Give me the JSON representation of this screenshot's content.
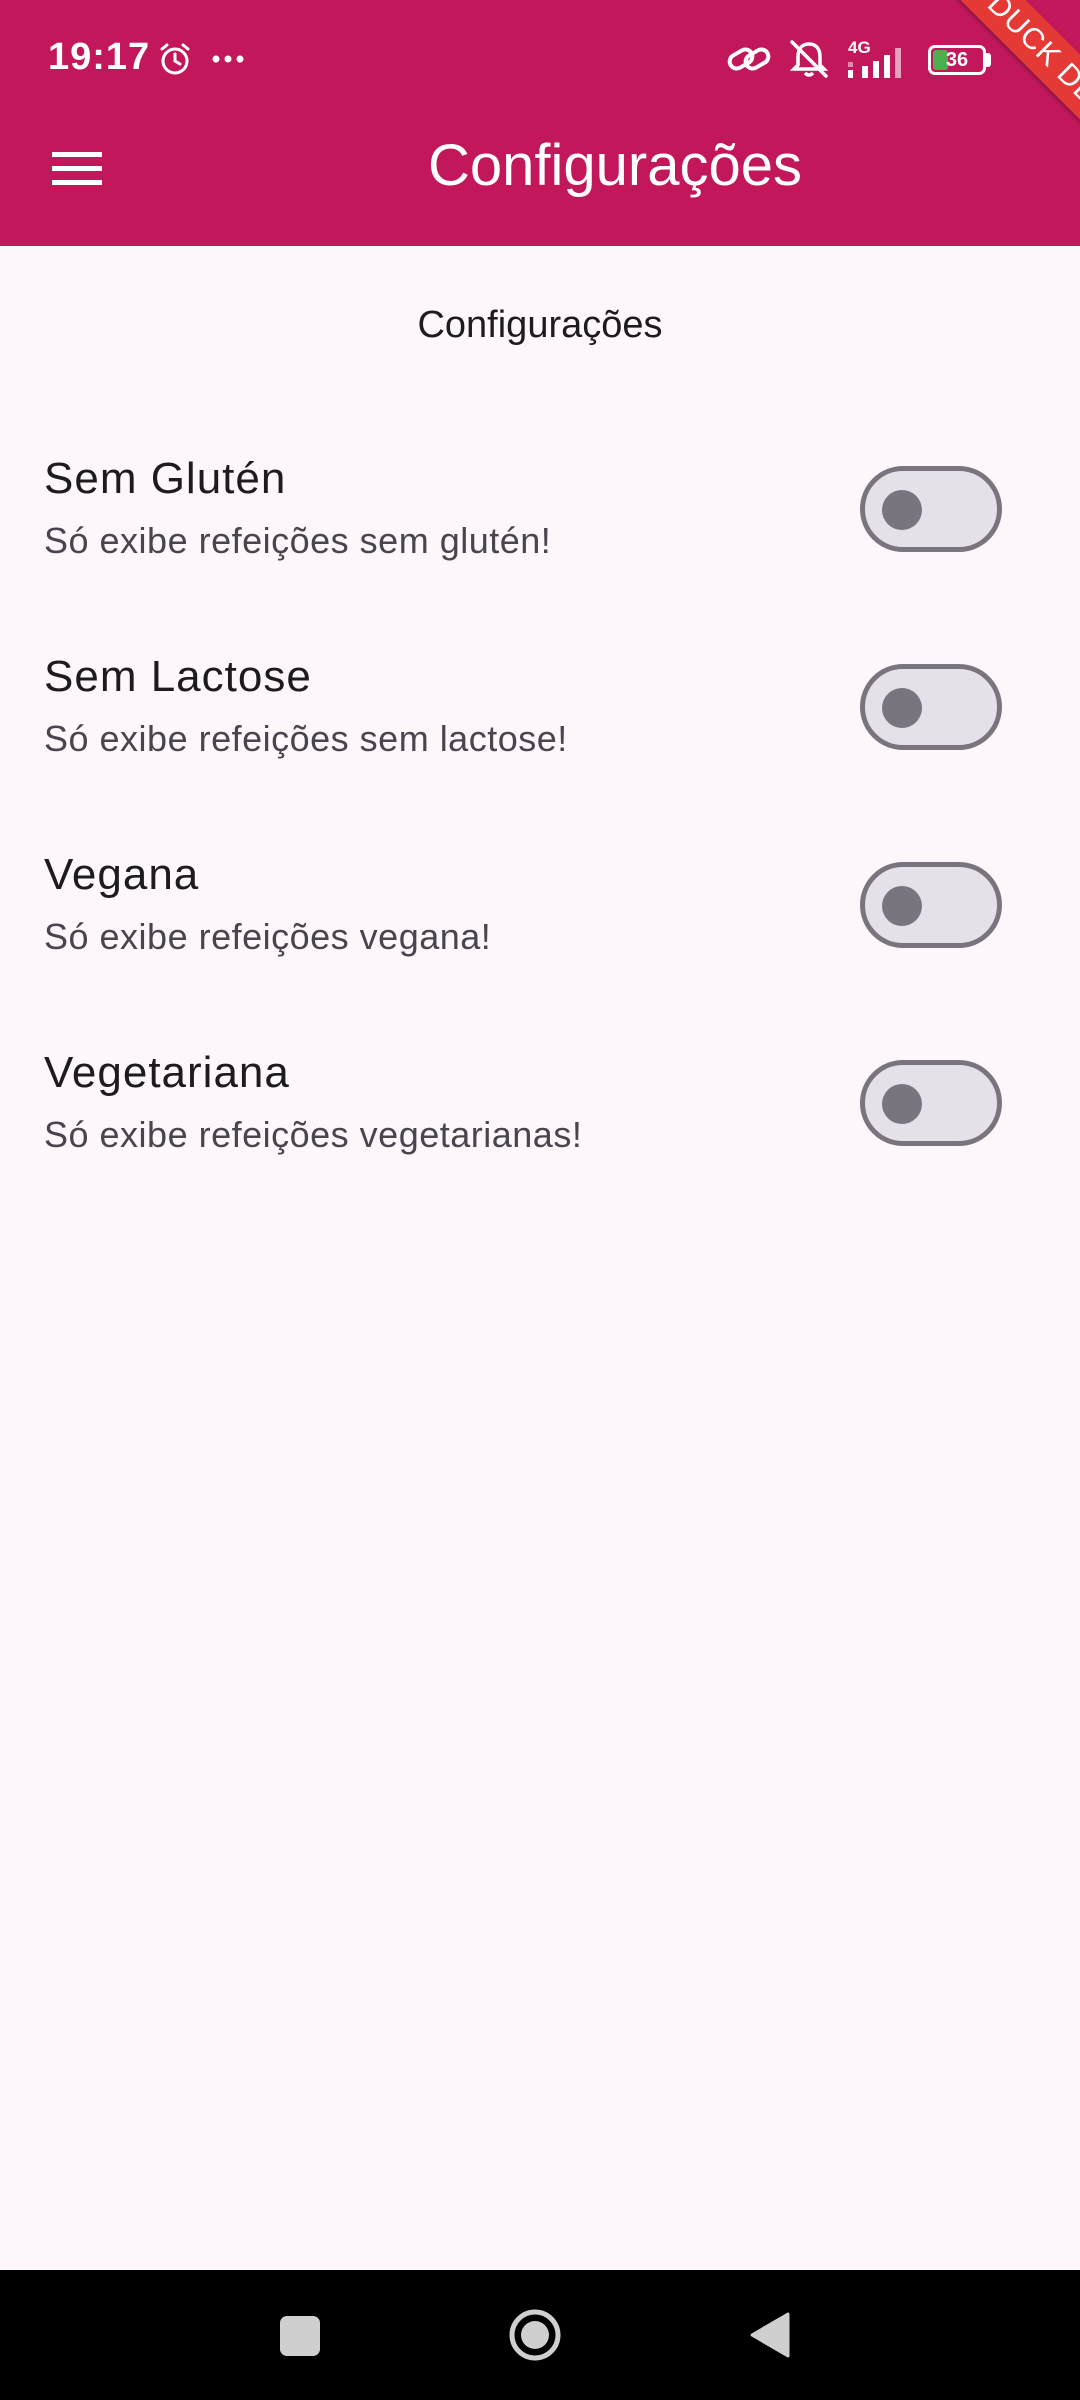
{
  "status_bar": {
    "time": "19:17",
    "network": "4G",
    "battery": "36",
    "icons": [
      "alarm-icon",
      "more-dots-icon",
      "link-icon",
      "vibrate-off-icon",
      "signal-icon",
      "battery-icon"
    ]
  },
  "debug_banner": "DUCK DEV",
  "app_bar": {
    "title": "Configurações",
    "menu_icon": "hamburger-menu-icon"
  },
  "section_title": "Configurações",
  "settings": [
    {
      "title": "Sem Glutén",
      "subtitle": "Só exibe refeições sem glutén!",
      "enabled": false
    },
    {
      "title": "Sem Lactose",
      "subtitle": "Só exibe refeições sem lactose!",
      "enabled": false
    },
    {
      "title": "Vegana",
      "subtitle": "Só exibe refeições vegana!",
      "enabled": false
    },
    {
      "title": "Vegetariana",
      "subtitle": "Só exibe refeições vegetarianas!",
      "enabled": false
    }
  ],
  "colors": {
    "primary": "#c2185b",
    "background": "#fdf7fc",
    "switch_outline": "#79747e",
    "switch_track": "#e6e0e9",
    "banner": "#e53935"
  },
  "nav_bar": {
    "icons": [
      "recents-square-icon",
      "home-circle-icon",
      "back-triangle-icon"
    ]
  }
}
